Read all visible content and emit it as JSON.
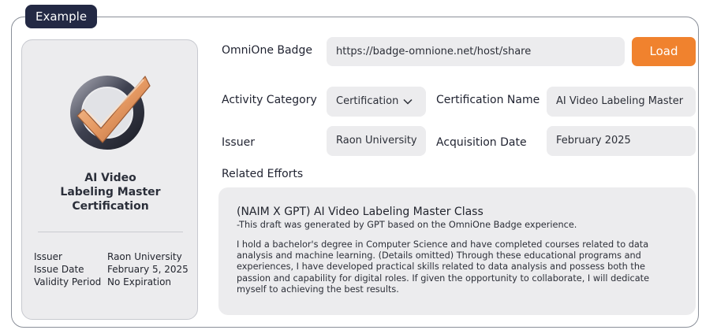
{
  "section_tag": "Example",
  "badge_card": {
    "icon": "checkmark-badge-icon",
    "title": "AI Video\nLabeling Master\nCertification",
    "meta": [
      {
        "key": "Issuer",
        "value": "Raon University"
      },
      {
        "key": "Issue Date",
        "value": "February 5, 2025"
      },
      {
        "key": "Validity Period",
        "value": "No Expiration"
      }
    ]
  },
  "form": {
    "omnione_badge_label": "OmniOne Badge",
    "omnione_badge_url": "https://badge-omnione.net/host/share",
    "load_button": "Load",
    "activity_category_label": "Activity Category",
    "activity_category_value": "Certification",
    "certification_name_label": "Certification Name",
    "certification_name_value": "AI Video Labeling Master",
    "issuer_label": "Issuer",
    "issuer_value": "Raon University",
    "acquisition_date_label": "Acquisition Date",
    "acquisition_date_value": "February 2025",
    "related_efforts_label": "Related Efforts"
  },
  "related_efforts": {
    "title": "(NAIM X GPT) AI Video Labeling Master Class",
    "subtitle": "-This draft was generated by GPT based on the OmniOne Badge experience.",
    "body": "I hold a bachelor's degree in Computer Science and have completed courses related to data analysis and machine learning. (Details omitted) Through these educational programs and experiences, I have developed practical skills related to data analysis and possess both the passion and capability for digital roles. If given the opportunity to collaborate, I will dedicate myself to achieving the best results."
  },
  "colors": {
    "accent": "#f0822e",
    "tag_bg": "#232944",
    "field_bg": "#ececee"
  }
}
